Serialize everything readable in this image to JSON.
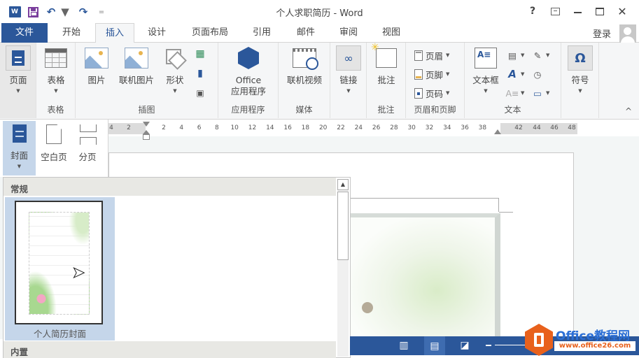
{
  "window": {
    "title": "个人求职简历 - Word",
    "controls": {
      "help": "?",
      "minimize": "–",
      "maximize": "□",
      "close": "✕"
    }
  },
  "quick_access": {
    "word_icon": "W",
    "undo": "↶",
    "redo": "↷",
    "customize": "="
  },
  "tabs": [
    {
      "label": "文件",
      "state": "file"
    },
    {
      "label": "开始"
    },
    {
      "label": "插入",
      "state": "active"
    },
    {
      "label": "设计"
    },
    {
      "label": "页面布局"
    },
    {
      "label": "引用"
    },
    {
      "label": "邮件"
    },
    {
      "label": "审阅"
    },
    {
      "label": "视图"
    }
  ],
  "account": {
    "signin": "登录"
  },
  "ribbon": {
    "groups": {
      "pages": {
        "button": "页面"
      },
      "tables": {
        "button": "表格",
        "label": "表格"
      },
      "illustrations": {
        "label": "插图",
        "picture": "图片",
        "online_picture": "联机图片",
        "shapes": "形状"
      },
      "apps": {
        "label": "应用程序",
        "line1": "Office",
        "line2": "应用程序"
      },
      "media": {
        "label": "媒体",
        "online_video": "联机视频"
      },
      "links": {
        "button": "链接"
      },
      "comments": {
        "label": "批注",
        "button": "批注"
      },
      "header_footer": {
        "label": "页眉和页脚",
        "header": "页眉",
        "footer": "页脚",
        "page_number": "页码"
      },
      "text": {
        "label": "文本",
        "textbox": "文本框",
        "wordart": "A"
      },
      "symbols": {
        "button": "符号",
        "icon": "Ω"
      }
    },
    "collapse": "^"
  },
  "ruler": {
    "left_ticks": [
      "4",
      "2"
    ],
    "ticks": [
      "2",
      "4",
      "6",
      "8",
      "10",
      "12",
      "14",
      "16",
      "18",
      "20",
      "22",
      "24",
      "26",
      "28",
      "30",
      "32",
      "34",
      "36",
      "38"
    ],
    "right_ticks": [
      "42",
      "44",
      "46",
      "48"
    ]
  },
  "pages_menu": {
    "cover": "封面",
    "blank": "空白页",
    "page_break": "分页"
  },
  "gallery": {
    "section_general": "常规",
    "section_builtin": "内置",
    "items": [
      {
        "caption": "个人简历封面"
      }
    ]
  },
  "watermark": {
    "title": "Office教程网",
    "url": "www.office26.com"
  }
}
